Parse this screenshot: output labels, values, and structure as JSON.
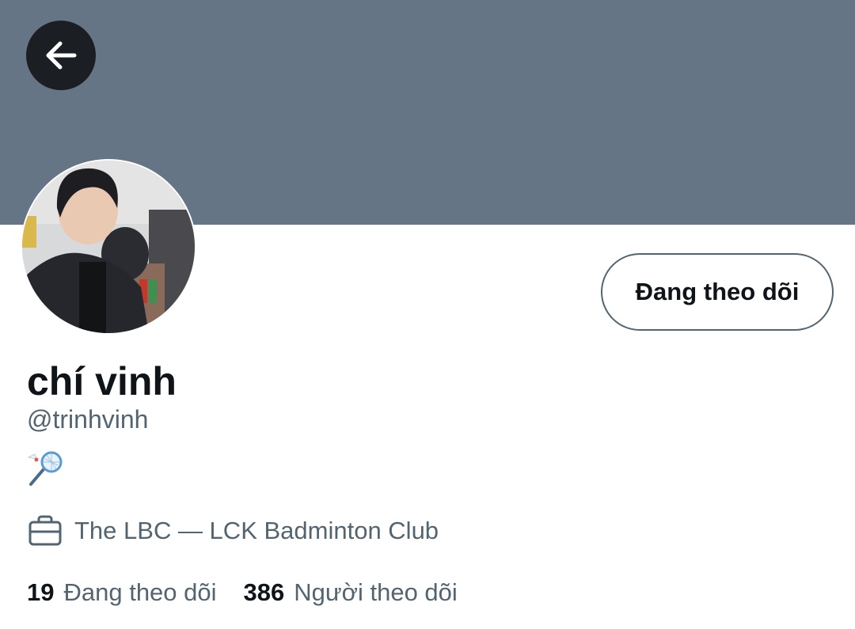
{
  "colors": {
    "banner": "#657585",
    "back_button_bg": "#1b1f23",
    "primary_text": "#0f1419",
    "secondary_text": "#536471",
    "button_border": "#536471"
  },
  "header": {
    "back_icon": "arrow-left-icon"
  },
  "profile": {
    "display_name": "chí vinh",
    "handle": "@trinhvinh",
    "bio_icon": "badminton-icon",
    "work_icon": "briefcase-icon",
    "work": "The LBC — LCK Badminton Club",
    "follow_button_label": "Đang theo dõi"
  },
  "stats": {
    "following_count": "19",
    "following_label": "Đang theo dõi",
    "followers_count": "386",
    "followers_label": "Người theo dõi"
  }
}
